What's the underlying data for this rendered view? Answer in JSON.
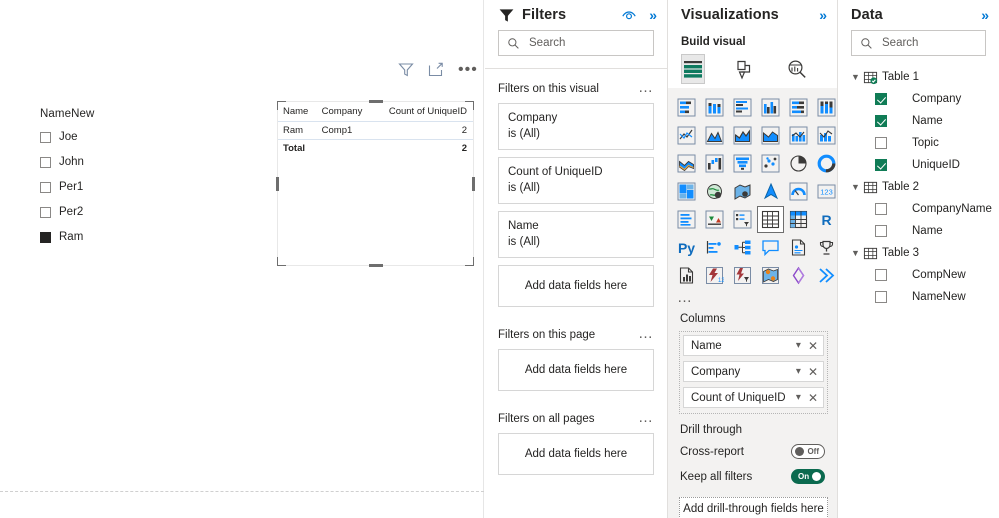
{
  "canvas": {
    "slicer": {
      "title": "NameNew",
      "items": [
        {
          "label": "Joe",
          "checked": false
        },
        {
          "label": "John",
          "checked": false
        },
        {
          "label": "Per1",
          "checked": false
        },
        {
          "label": "Per2",
          "checked": false
        },
        {
          "label": "Ram",
          "checked": true
        }
      ]
    },
    "visual_header": {
      "filter_icon": "filter-icon",
      "focus_icon": "focus-mode-icon",
      "more_label": "•••"
    },
    "table_visual": {
      "columns": [
        "Name",
        "Company",
        "Count of UniqueID"
      ],
      "rows": [
        {
          "name": "Ram",
          "company": "Comp1",
          "count": "2"
        }
      ],
      "total": {
        "label": "Total",
        "count": "2"
      }
    }
  },
  "filters": {
    "title": "Filters",
    "hide_icon": "eye-icon",
    "collapse_icon": "chevron-double-right-icon",
    "search_placeholder": "Search",
    "search_value": "",
    "groups": [
      {
        "title": "Filters on this visual",
        "more_label": "…",
        "cards": [
          {
            "field": "Company",
            "value": "is (All)"
          },
          {
            "field": "Count of UniqueID",
            "value": "is (All)"
          },
          {
            "field": "Name",
            "value": "is (All)"
          }
        ],
        "dropzone": "Add data fields here"
      },
      {
        "title": "Filters on this page",
        "more_label": "…",
        "cards": [],
        "dropzone": "Add data fields here"
      },
      {
        "title": "Filters on all pages",
        "more_label": "…",
        "cards": [],
        "dropzone": "Add data fields here"
      }
    ]
  },
  "visualizations": {
    "title": "Visualizations",
    "collapse_icon": "chevron-double-right-icon",
    "build_label": "Build visual",
    "build_tabs": [
      {
        "name": "fields-tab",
        "icon": "table-fields-icon",
        "selected": true
      },
      {
        "name": "format-tab",
        "icon": "paintbrush-icon",
        "selected": false
      },
      {
        "name": "analytics-tab",
        "icon": "magnifier-chart-icon",
        "selected": false
      }
    ],
    "gallery_more": "…",
    "gallery": [
      {
        "icon": "stacked-bar-chart-icon",
        "selected": false
      },
      {
        "icon": "stacked-column-chart-icon",
        "selected": false
      },
      {
        "icon": "clustered-bar-chart-icon",
        "selected": false
      },
      {
        "icon": "clustered-column-chart-icon",
        "selected": false
      },
      {
        "icon": "hundred-stacked-bar-chart-icon",
        "selected": false
      },
      {
        "icon": "hundred-stacked-column-chart-icon",
        "selected": false
      },
      {
        "icon": "line-chart-icon",
        "selected": false
      },
      {
        "icon": "area-chart-icon",
        "selected": false
      },
      {
        "icon": "stacked-area-chart-icon",
        "selected": false
      },
      {
        "icon": "line-stacked-column-icon",
        "selected": false
      },
      {
        "icon": "line-clustered-column-icon",
        "selected": false
      },
      {
        "icon": "line-column-combo-icon",
        "selected": false
      },
      {
        "icon": "ribbon-chart-icon",
        "selected": false
      },
      {
        "icon": "waterfall-chart-icon",
        "selected": false
      },
      {
        "icon": "funnel-chart-icon",
        "selected": false
      },
      {
        "icon": "scatter-chart-icon",
        "selected": false
      },
      {
        "icon": "pie-chart-icon",
        "selected": false
      },
      {
        "icon": "donut-chart-icon",
        "selected": false
      },
      {
        "icon": "treemap-icon",
        "selected": false
      },
      {
        "icon": "map-icon",
        "selected": false
      },
      {
        "icon": "filled-map-icon",
        "selected": false
      },
      {
        "icon": "azure-map-icon",
        "selected": false
      },
      {
        "icon": "gauge-icon",
        "selected": false
      },
      {
        "icon": "card-icon",
        "selected": false
      },
      {
        "icon": "multi-row-card-icon",
        "selected": false
      },
      {
        "icon": "kpi-icon",
        "selected": false
      },
      {
        "icon": "slicer-icon",
        "selected": false
      },
      {
        "icon": "table-icon",
        "selected": true
      },
      {
        "icon": "matrix-icon",
        "selected": false
      },
      {
        "icon": "r-script-visual-icon",
        "selected": false
      },
      {
        "icon": "python-visual-icon",
        "selected": false
      },
      {
        "icon": "key-influencers-icon",
        "selected": false
      },
      {
        "icon": "decomposition-tree-icon",
        "selected": false
      },
      {
        "icon": "qa-visual-icon",
        "selected": false
      },
      {
        "icon": "smart-narrative-icon",
        "selected": false
      },
      {
        "icon": "metrics-icon",
        "selected": false
      },
      {
        "icon": "paginated-report-icon",
        "selected": false
      },
      {
        "icon": "power-apps-icon",
        "selected": false
      },
      {
        "icon": "power-automate-icon",
        "selected": false
      },
      {
        "icon": "arcgis-maps-icon",
        "selected": false
      },
      {
        "icon": "visio-icon",
        "selected": false
      },
      {
        "icon": "power-platform-icon",
        "selected": false
      }
    ],
    "wells": {
      "columns_label": "Columns",
      "columns": [
        {
          "name": "Name"
        },
        {
          "name": "Company"
        },
        {
          "name": "Count of UniqueID"
        }
      ]
    },
    "drill": {
      "label": "Drill through",
      "cross_report": {
        "label": "Cross-report",
        "state": "Off",
        "on": false
      },
      "keep_all_filters": {
        "label": "Keep all filters",
        "state": "On",
        "on": true
      },
      "dropzone": "Add drill-through fields here"
    }
  },
  "data": {
    "title": "Data",
    "collapse_icon": "chevron-double-right-icon",
    "search_placeholder": "Search",
    "search_value": "",
    "tables": [
      {
        "name": "Table 1",
        "expanded": true,
        "badge": true,
        "fields": [
          {
            "name": "Company",
            "checked": true
          },
          {
            "name": "Name",
            "checked": true
          },
          {
            "name": "Topic",
            "checked": false
          },
          {
            "name": "UniqueID",
            "checked": true
          }
        ]
      },
      {
        "name": "Table 2",
        "expanded": true,
        "badge": false,
        "fields": [
          {
            "name": "CompanyName",
            "checked": false
          },
          {
            "name": "Name",
            "checked": false
          }
        ]
      },
      {
        "name": "Table 3",
        "expanded": true,
        "badge": false,
        "fields": [
          {
            "name": "CompNew",
            "checked": false
          },
          {
            "name": "NameNew",
            "checked": false
          }
        ]
      }
    ]
  },
  "colors": {
    "accent": "#0078d4",
    "viz_blue": "#118DFF",
    "check_green": "#107c56",
    "toggle_on": "#0b6a4f",
    "text": "#252423"
  }
}
